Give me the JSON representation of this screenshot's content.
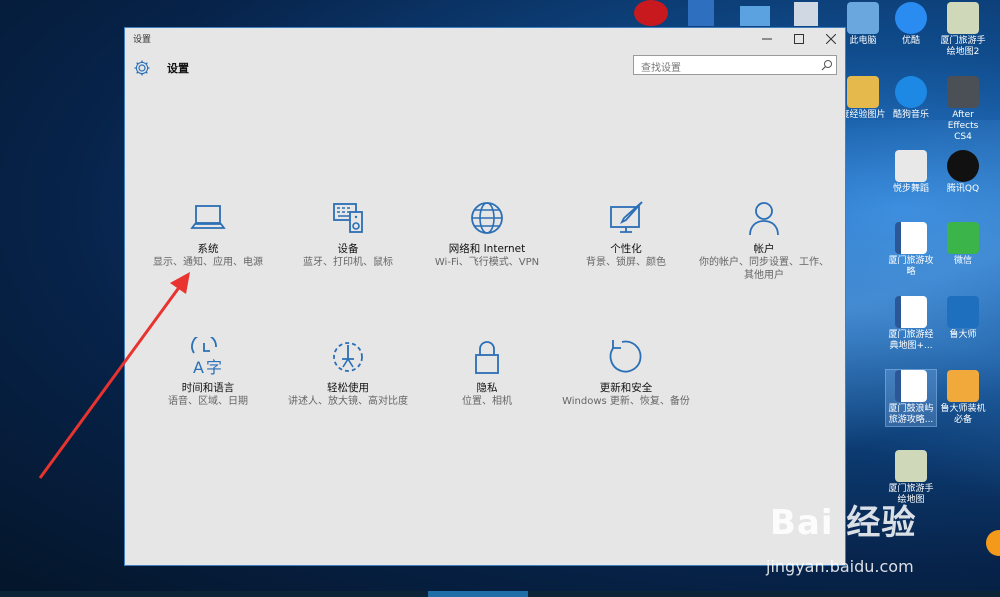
{
  "window": {
    "title": "设置",
    "header_title": "设置",
    "search_placeholder": "查找设置"
  },
  "tiles": [
    {
      "name": "系统",
      "desc": "显示、通知、应用、电源",
      "icon": "laptop-icon"
    },
    {
      "name": "设备",
      "desc": "蓝牙、打印机、鼠标",
      "icon": "devices-icon"
    },
    {
      "name": "网络和 Internet",
      "desc": "Wi-Fi、飞行模式、VPN",
      "icon": "globe-icon"
    },
    {
      "name": "个性化",
      "desc": "背景、锁屏、颜色",
      "icon": "paint-icon"
    },
    {
      "name": "帐户",
      "desc": "你的帐户、同步设置、工作、其他用户",
      "icon": "person-icon"
    },
    {
      "name": "时间和语言",
      "desc": "语音、区域、日期",
      "icon": "time-language-icon"
    },
    {
      "name": "轻松使用",
      "desc": "讲述人、放大镜、高对比度",
      "icon": "ease-of-access-icon"
    },
    {
      "name": "隐私",
      "desc": "位置、相机",
      "icon": "lock-icon"
    },
    {
      "name": "更新和安全",
      "desc": "Windows 更新、恢复、备份",
      "icon": "update-icon"
    }
  ],
  "desktop_icons": [
    {
      "label": "此电脑",
      "color": "#6aa7de"
    },
    {
      "label": "优酷",
      "color": "#2a8cf0"
    },
    {
      "label": "厦门旅游手绘地图2",
      "color": "#cfd9b9"
    },
    {
      "label": "度经验图片",
      "color": "#e6b94c"
    },
    {
      "label": "酷狗音乐",
      "color": "#1e88e5"
    },
    {
      "label": "After Effects CS4",
      "color": "#4b4f56"
    },
    {
      "label": "悦步舞蹈",
      "color": "#e8e8e8"
    },
    {
      "label": "腾讯QQ",
      "color": "#111111"
    },
    {
      "label": "厦门旅游攻略",
      "color": "#2b5797"
    },
    {
      "label": "微信",
      "color": "#3bb54a"
    },
    {
      "label": "厦门旅游经典地图+...",
      "color": "#2b5797"
    },
    {
      "label": "鲁大师",
      "color": "#1f6fbf"
    },
    {
      "label": "厦门鼓浪屿旅游攻略...",
      "color": "#2b5797"
    },
    {
      "label": "鲁大师装机必备",
      "color": "#f2a93b"
    },
    {
      "label": "厦门旅游手绘地图",
      "color": "#cfd9b9"
    }
  ],
  "watermark": {
    "brand": "Bai 经验",
    "url": "jingyan.baidu.com"
  },
  "accent": "#3f7fbf",
  "arrow_color": "#e8332e"
}
